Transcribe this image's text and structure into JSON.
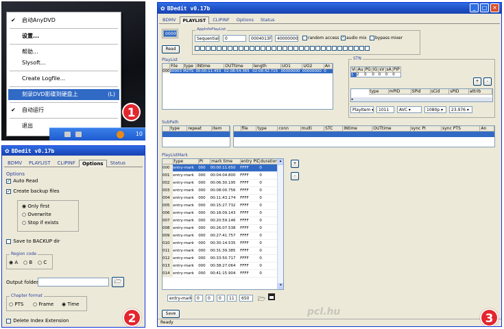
{
  "panel1": {
    "menu_items": [
      "启动AnyDVD",
      "设置...",
      "帮助...",
      "Slysoft...",
      "Create Logfile...",
      "刻录DVD影碟到硬盘上",
      "自动运行",
      "退出"
    ],
    "menu_shortcut": "(L)",
    "tray_time": "10",
    "badge": "1"
  },
  "panel2": {
    "title": "BDedit  v0.17b",
    "tabs": [
      "BDMV",
      "PLAYLIST",
      "CLIPINF",
      "Options",
      "Status"
    ],
    "options_group": "Options",
    "auto_read": "Auto Read",
    "create_backup": "Create backup files",
    "radio_only_first": "Only first",
    "radio_overwrite": "Overwrite",
    "radio_stop": "Stop if exists",
    "save_backup": "Save to BACKUP dir",
    "region_group": "Region code",
    "region_a": "A",
    "region_b": "B",
    "region_c": "C",
    "output_folder": "Output folder",
    "chapter_group": "Chapter format",
    "ch_pts": "PTS",
    "ch_frame": "Frame",
    "ch_time": "Time",
    "delete_index": "Delete Index Extension",
    "badge": "2"
  },
  "panel3": {
    "title": "BDedit  v0.17b",
    "tabs": [
      "BDMV",
      "PLAYLIST",
      "CLIPINF",
      "Options",
      "Status"
    ],
    "read_label": "Read",
    "mpls_value": "00000",
    "app_info_label": "AppInfoPlayList",
    "sequential": "Sequential",
    "app_field_1": "0",
    "app_field_2": "0004013F",
    "app_field_3": "40000000",
    "random_access": "random access",
    "audio_mix": "audio mix",
    "bypass_mixer": "bypass mixer",
    "playlist_label": "PlayList",
    "playlist_headers": [
      "File",
      "type",
      "INtime",
      "OUTtime",
      "length",
      "UO1",
      "UO2",
      "An"
    ],
    "playlist_row": [
      "00003",
      "M2TS",
      "00:00:11.453",
      "02:08:54.365",
      "02:08:42.715",
      "00000000",
      "00000000",
      "0"
    ],
    "playlist_row_id": "000",
    "stn_label": "STN",
    "stn_headers": [
      "Vi",
      "Au",
      "PG",
      "IG",
      "sV",
      "sA",
      "PIP"
    ],
    "stn_values": [
      "1",
      "2",
      "0",
      "0",
      "0",
      "0",
      "0"
    ],
    "stream_headers": [
      "type",
      "mPID",
      "SPid",
      "sCid",
      "sPID",
      "attrib"
    ],
    "playitem": "PlayItem",
    "stream_pid": "1011",
    "codec": "AVC",
    "resolution": "1080p",
    "framerate": "23.976",
    "subpath_label": "SubPath",
    "subpath_headers": [
      "type",
      "repeat",
      "item"
    ],
    "subpath_headers2": [
      "file",
      "type",
      "conn",
      "multi",
      "STC",
      "INtime",
      "OUTtime",
      "sync PI",
      "sync PTS",
      "An"
    ],
    "mark_label": "PlayListMark",
    "mark_headers": [
      "type",
      "PI",
      "mark time",
      "entry PID",
      "duration"
    ],
    "mark_rows": [
      [
        "000",
        "entry-mark",
        "000",
        "00:00:11.650",
        "FFFF",
        "0"
      ],
      [
        "001",
        "entry-mark",
        "000",
        "00:04:04.800",
        "FFFF",
        "0"
      ],
      [
        "002",
        "entry-mark",
        "000",
        "00:06:30.195",
        "FFFF",
        "0"
      ],
      [
        "003",
        "entry-mark",
        "000",
        "00:08:00.756",
        "FFFF",
        "0"
      ],
      [
        "004",
        "entry-mark",
        "000",
        "00:11:43.174",
        "FFFF",
        "0"
      ],
      [
        "005",
        "entry-mark",
        "000",
        "00:15:27.732",
        "FFFF",
        "0"
      ],
      [
        "006",
        "entry-mark",
        "000",
        "00:18:09.143",
        "FFFF",
        "0"
      ],
      [
        "007",
        "entry-mark",
        "000",
        "00:20:59.146",
        "FFFF",
        "0"
      ],
      [
        "008",
        "entry-mark",
        "000",
        "00:26:07.538",
        "FFFF",
        "0"
      ],
      [
        "009",
        "entry-mark",
        "000",
        "00:27:41.757",
        "FFFF",
        "0"
      ],
      [
        "010",
        "entry-mark",
        "000",
        "00:30:14.535",
        "FFFF",
        "0"
      ],
      [
        "011",
        "entry-mark",
        "000",
        "00:31:39.385",
        "FFFF",
        "0"
      ],
      [
        "012",
        "entry-mark",
        "000",
        "00:33:50.717",
        "FFFF",
        "0"
      ],
      [
        "013",
        "entry-mark",
        "000",
        "00:38:27.064",
        "FFFF",
        "0"
      ],
      [
        "014",
        "entry-mark",
        "000",
        "00:41:15.904",
        "FFFF",
        "0"
      ]
    ],
    "bottom_type": "entry-mark",
    "bottom_f1": "0",
    "bottom_f2": "0",
    "bottom_f3": "0",
    "bottom_f4": "11",
    "bottom_f5": "650",
    "save_label": "Save",
    "watermark": "pcl.hu",
    "status": "Ready",
    "badge": "3"
  }
}
